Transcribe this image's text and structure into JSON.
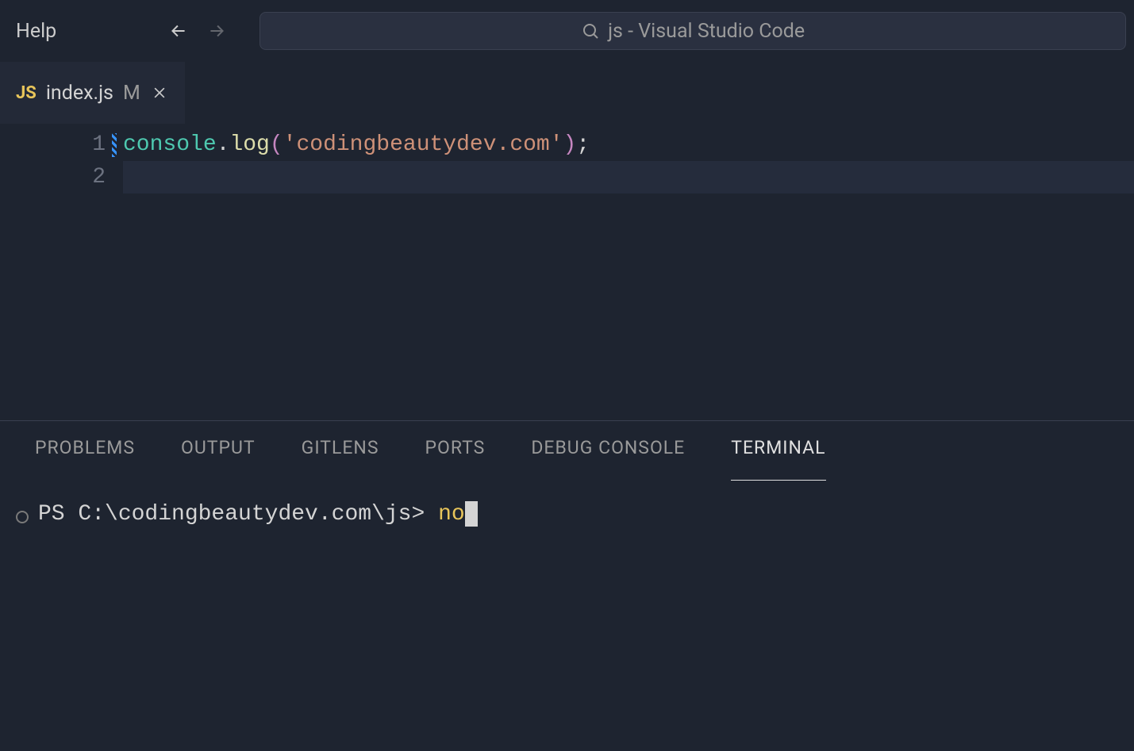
{
  "menu": {
    "help_label": "Help"
  },
  "search": {
    "text": "js - Visual Studio Code"
  },
  "tab": {
    "icon_text": "JS",
    "filename": "index.js",
    "modified_badge": "M"
  },
  "editor": {
    "lines": {
      "l1_num": "1",
      "l2_num": "2"
    },
    "code": {
      "obj": "console",
      "dot": ".",
      "method": "log",
      "open_paren": "(",
      "string": "'codingbeautydev.com'",
      "close_paren": ")",
      "semi": ";"
    }
  },
  "panel": {
    "tabs": {
      "problems": "PROBLEMS",
      "output": "OUTPUT",
      "gitlens": "GITLENS",
      "ports": "PORTS",
      "debug": "DEBUG CONSOLE",
      "terminal": "TERMINAL"
    }
  },
  "terminal": {
    "prompt": "PS C:\\codingbeautydev.com\\js> ",
    "command": "no"
  }
}
